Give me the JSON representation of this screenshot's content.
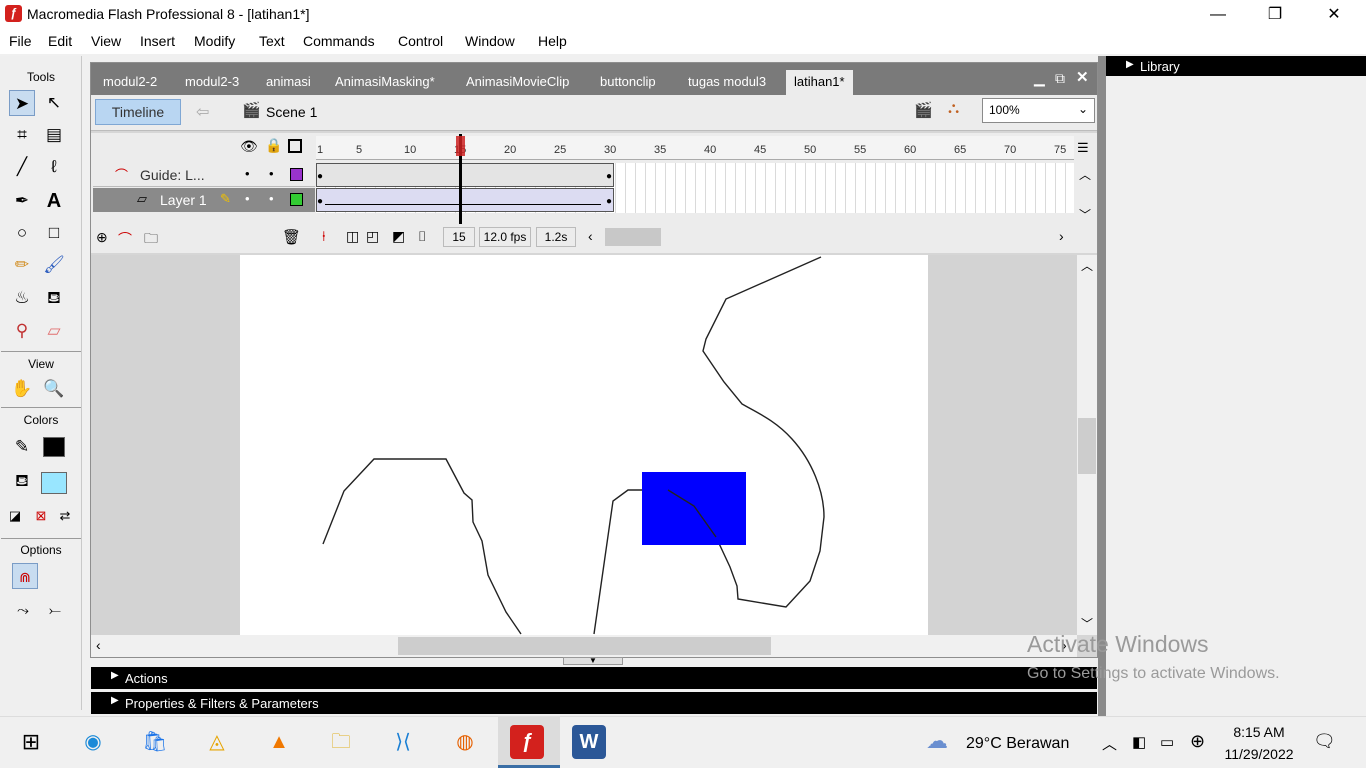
{
  "window": {
    "title": "Macromedia Flash Professional 8 - [latihan1*]",
    "minimize": "—",
    "maximize": "❐",
    "close": "✕"
  },
  "menu": [
    "File",
    "Edit",
    "View",
    "Insert",
    "Modify",
    "Text",
    "Commands",
    "Control",
    "Window",
    "Help"
  ],
  "toolbox": {
    "tools_label": "Tools",
    "view_label": "View",
    "colors_label": "Colors",
    "options_label": "Options"
  },
  "tabs": [
    "modul2-2",
    "modul2-3",
    "animasi",
    "AnimasiMasking*",
    "AnimasiMovieClip",
    "buttonclip",
    "tugas modul3",
    "latihan1*"
  ],
  "timeline_bar": {
    "timeline_button": "Timeline",
    "scene": "Scene 1",
    "zoom": "100%"
  },
  "timeline": {
    "ruler": [
      "1",
      "5",
      "10",
      "15",
      "20",
      "25",
      "30",
      "35",
      "40",
      "45",
      "50",
      "55",
      "60",
      "65",
      "70",
      "75"
    ],
    "layers": [
      {
        "name": "Guide: L...",
        "color": "#9933cc"
      },
      {
        "name": "Layer 1",
        "color": "#33cc33"
      }
    ],
    "current_frame": "15",
    "fps": "12.0 fps",
    "time": "1.2s"
  },
  "stage": {
    "rect_color": "#0000ff"
  },
  "panels": {
    "actions": "Actions",
    "properties": "Properties & Filters & Parameters",
    "library": "Library"
  },
  "watermark": {
    "line1": "Activate Windows",
    "line2": "Go to Settings to activate Windows."
  },
  "taskbar": {
    "weather": "29°C  Berawan",
    "time": "8:15 AM",
    "date": "11/29/2022"
  }
}
